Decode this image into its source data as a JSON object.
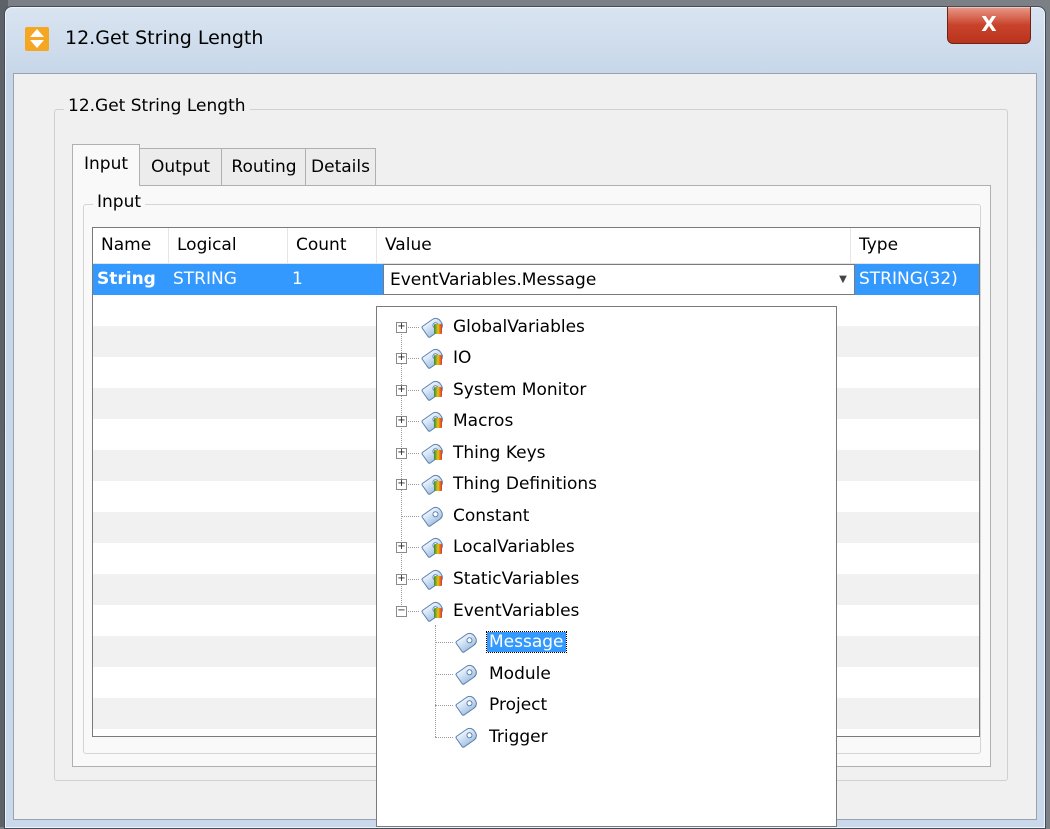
{
  "window": {
    "title": "12.Get String Length",
    "close_label": "X"
  },
  "groupbox": {
    "label": "12.Get String Length"
  },
  "tabs": [
    {
      "label": "Input"
    },
    {
      "label": "Output"
    },
    {
      "label": "Routing"
    },
    {
      "label": "Details"
    }
  ],
  "input_group": {
    "label": "Input"
  },
  "grid": {
    "columns": [
      "Name",
      "Logical",
      "Count",
      "Value",
      "Type"
    ],
    "row": {
      "name": "String",
      "logical": "STRING",
      "count": "1",
      "value": "EventVariables.Message",
      "type": "STRING(32)"
    }
  },
  "tree": [
    {
      "label": "GlobalVariables",
      "expander": "+"
    },
    {
      "label": "IO",
      "expander": "+"
    },
    {
      "label": "System Monitor",
      "expander": "+"
    },
    {
      "label": "Macros",
      "expander": "+"
    },
    {
      "label": "Thing Keys",
      "expander": "+"
    },
    {
      "label": "Thing Definitions",
      "expander": "+"
    },
    {
      "label": "Constant",
      "expander": ""
    },
    {
      "label": "LocalVariables",
      "expander": "+"
    },
    {
      "label": "StaticVariables",
      "expander": "+"
    },
    {
      "label": "EventVariables",
      "expander": "−"
    },
    {
      "label": "Message"
    },
    {
      "label": "Module"
    },
    {
      "label": "Project"
    },
    {
      "label": "Trigger"
    }
  ],
  "colors": {
    "selection": "#3399ff",
    "accent_icon": "#f5a623"
  }
}
